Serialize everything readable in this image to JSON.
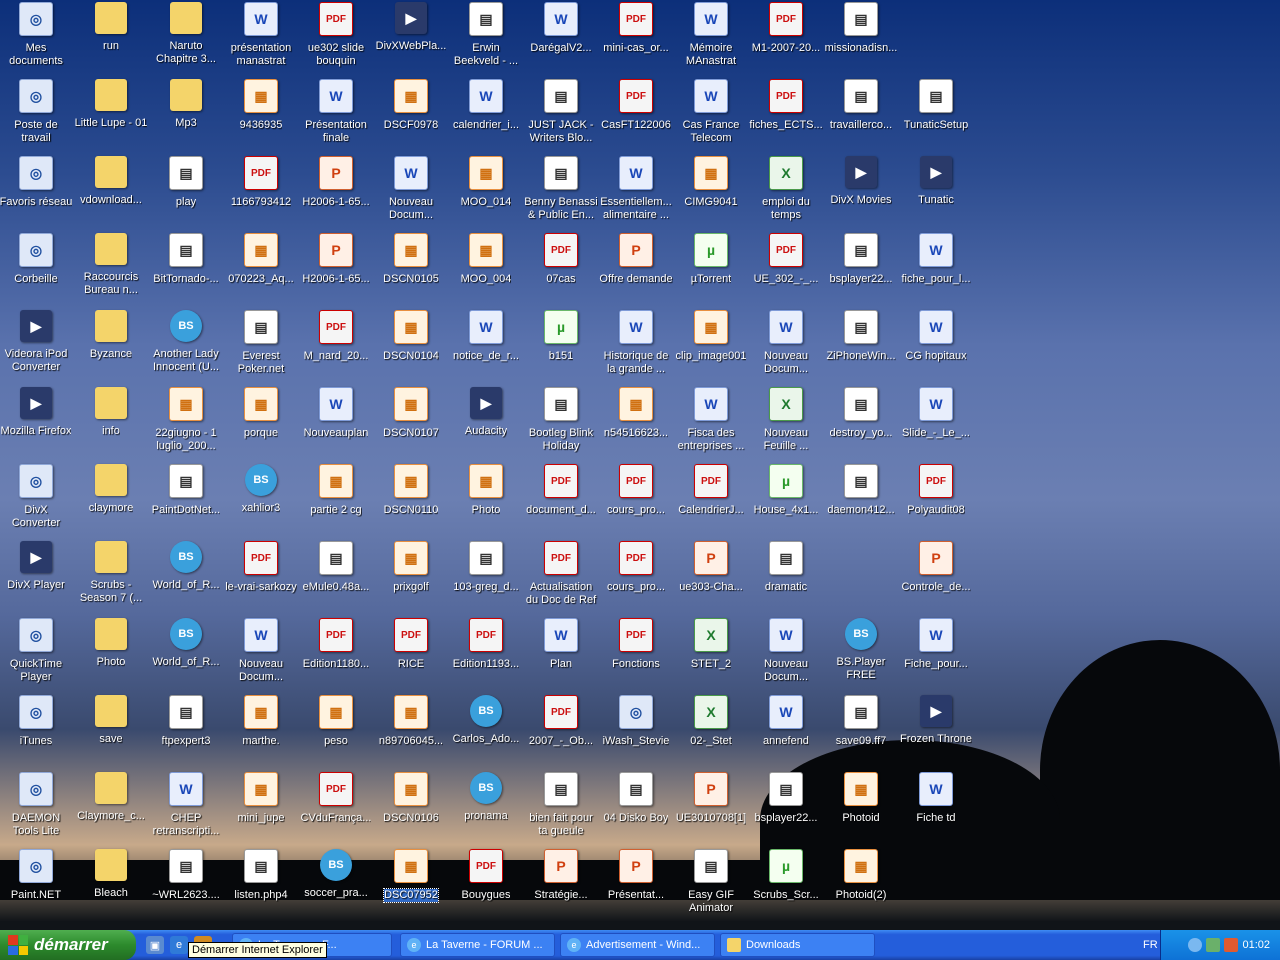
{
  "desktop": {
    "columns": [
      [
        {
          "label": "Mes documents",
          "icon": "my-documents-icon",
          "type": "sys"
        },
        {
          "label": "Poste de travail",
          "icon": "my-computer-icon",
          "type": "sys"
        },
        {
          "label": "Favoris réseau",
          "icon": "network-icon",
          "type": "sys"
        },
        {
          "label": "Corbeille",
          "icon": "recycle-bin-icon",
          "type": "sys"
        },
        {
          "label": "Videora iPod Converter",
          "icon": "videora-icon",
          "type": "app"
        },
        {
          "label": "Mozilla Firefox",
          "icon": "firefox-icon",
          "type": "app"
        },
        {
          "label": "DivX Converter",
          "icon": "divx-converter-icon",
          "type": "sys"
        },
        {
          "label": "DivX Player",
          "icon": "divx-player-icon",
          "type": "app"
        },
        {
          "label": "QuickTime Player",
          "icon": "quicktime-icon",
          "type": "sys"
        },
        {
          "label": "iTunes",
          "icon": "itunes-icon",
          "type": "sys"
        },
        {
          "label": "DAEMON Tools Lite",
          "icon": "daemon-tools-icon",
          "type": "sys"
        },
        {
          "label": "Paint.NET",
          "icon": "paint-net-icon",
          "type": "sys"
        }
      ],
      [
        {
          "label": "run",
          "icon": "folder-icon",
          "type": "folder"
        },
        {
          "label": "Little Lupe - 01",
          "icon": "folder-icon",
          "type": "folder"
        },
        {
          "label": "vdownload...",
          "icon": "folder-icon",
          "type": "folder"
        },
        {
          "label": "Raccourcis Bureau n...",
          "icon": "folder-icon",
          "type": "folder"
        },
        {
          "label": "Byzance",
          "icon": "folder-icon",
          "type": "folder"
        },
        {
          "label": "info",
          "icon": "folder-icon",
          "type": "folder"
        },
        {
          "label": "claymore",
          "icon": "folder-icon",
          "type": "folder"
        },
        {
          "label": "Scrubs - Season 7 (...",
          "icon": "folder-icon",
          "type": "folder"
        },
        {
          "label": "Photo",
          "icon": "folder-icon",
          "type": "folder"
        },
        {
          "label": "save",
          "icon": "folder-icon",
          "type": "folder"
        },
        {
          "label": "Claymore_c...",
          "icon": "folder-icon",
          "type": "folder"
        },
        {
          "label": "Bleach",
          "icon": "folder-icon",
          "type": "folder"
        }
      ],
      [
        {
          "label": "Naruto Chapitre 3...",
          "icon": "folder-icon",
          "type": "folder"
        },
        {
          "label": "Mp3",
          "icon": "folder-icon",
          "type": "folder"
        },
        {
          "label": "play",
          "icon": "movie-icon",
          "type": "misc"
        },
        {
          "label": "BitTornado-...",
          "icon": "bittornado-icon",
          "type": "misc"
        },
        {
          "label": "Another Lady Innocent (U...",
          "icon": "bsplayer-icon",
          "type": "bs"
        },
        {
          "label": "22giugno - 1 luglio_200...",
          "icon": "image-icon",
          "type": "img"
        },
        {
          "label": "PaintDotNet...",
          "icon": "paintdotnet-icon",
          "type": "misc"
        },
        {
          "label": "World_of_R...",
          "icon": "bsplayer-icon",
          "type": "bs"
        },
        {
          "label": "World_of_R...",
          "icon": "bsplayer-icon",
          "type": "bs"
        },
        {
          "label": "ftpexpert3",
          "icon": "installer-icon",
          "type": "misc"
        },
        {
          "label": "CHEP retranscripti...",
          "icon": "word-doc-icon",
          "type": "word"
        },
        {
          "label": "~WRL2623....",
          "icon": "archive-icon",
          "type": "misc"
        }
      ],
      [
        {
          "label": "présentation manastrat",
          "icon": "word-doc-icon",
          "type": "word"
        },
        {
          "label": "9436935",
          "icon": "image-icon",
          "type": "img"
        },
        {
          "label": "1166793412",
          "icon": "pdf-icon",
          "type": "pdf"
        },
        {
          "label": "070223_Aq...",
          "icon": "image-icon",
          "type": "img"
        },
        {
          "label": "Everest Poker.net",
          "icon": "everest-poker-icon",
          "type": "misc"
        },
        {
          "label": "porque",
          "icon": "image-icon",
          "type": "img"
        },
        {
          "label": "xahlior3",
          "icon": "bsplayer-icon",
          "type": "bs"
        },
        {
          "label": "le-vrai-sarkozy",
          "icon": "pdf-icon",
          "type": "pdf"
        },
        {
          "label": "Nouveau Docum...",
          "icon": "word-doc-icon",
          "type": "word"
        },
        {
          "label": "marthe.",
          "icon": "image-icon",
          "type": "img"
        },
        {
          "label": "mini_jupe",
          "icon": "image-icon",
          "type": "img"
        },
        {
          "label": "listen.php4",
          "icon": "file-icon",
          "type": "misc"
        }
      ],
      [
        {
          "label": "ue302 slide bouquin",
          "icon": "pdf-icon",
          "type": "pdf"
        },
        {
          "label": "Présentation finale",
          "icon": "word-doc-icon",
          "type": "word"
        },
        {
          "label": "H2006-1-65...",
          "icon": "powerpoint-icon",
          "type": "ppt"
        },
        {
          "label": "H2006-1-65...",
          "icon": "powerpoint-icon",
          "type": "ppt"
        },
        {
          "label": "M_nard_20...",
          "icon": "pdf-icon",
          "type": "pdf"
        },
        {
          "label": "Nouveauplan",
          "icon": "word-doc-icon",
          "type": "word"
        },
        {
          "label": "partie 2 cg",
          "icon": "image-icon",
          "type": "img"
        },
        {
          "label": "eMule0.48a...",
          "icon": "installer-icon",
          "type": "misc"
        },
        {
          "label": "Edition1180...",
          "icon": "pdf-icon",
          "type": "pdf"
        },
        {
          "label": "peso",
          "icon": "image-icon",
          "type": "img"
        },
        {
          "label": "CVduFrança...",
          "icon": "pdf-icon",
          "type": "pdf"
        },
        {
          "label": "soccer_pra...",
          "icon": "bsplayer-icon",
          "type": "bs"
        }
      ],
      [
        {
          "label": "DivXWebPla...",
          "icon": "divx-web-player-icon",
          "type": "app"
        },
        {
          "label": "DSCF0978",
          "icon": "image-icon",
          "type": "img"
        },
        {
          "label": "Nouveau Docum...",
          "icon": "word-doc-icon",
          "type": "word"
        },
        {
          "label": "DSCN0105",
          "icon": "image-icon",
          "type": "img"
        },
        {
          "label": "DSCN0104",
          "icon": "image-icon",
          "type": "img"
        },
        {
          "label": "DSCN0107",
          "icon": "image-icon",
          "type": "img"
        },
        {
          "label": "DSCN0110",
          "icon": "image-icon",
          "type": "img"
        },
        {
          "label": "prixgolf",
          "icon": "image-icon",
          "type": "img"
        },
        {
          "label": "RICE",
          "icon": "pdf-icon",
          "type": "pdf"
        },
        {
          "label": "n89706045...",
          "icon": "image-icon",
          "type": "img"
        },
        {
          "label": "DSCN0106",
          "icon": "image-icon",
          "type": "img"
        },
        {
          "label": "DSC07952",
          "icon": "image-icon",
          "type": "img",
          "selected": true
        }
      ],
      [
        {
          "label": "Erwin Beekveld - ...",
          "icon": "media-file-icon",
          "type": "misc"
        },
        {
          "label": "calendrier_i...",
          "icon": "word-doc-icon",
          "type": "word"
        },
        {
          "label": "MOO_014",
          "icon": "image-icon",
          "type": "img"
        },
        {
          "label": "MOO_004",
          "icon": "image-icon",
          "type": "img"
        },
        {
          "label": "notice_de_r...",
          "icon": "word-doc-icon",
          "type": "word"
        },
        {
          "label": "Audacity",
          "icon": "audacity-icon",
          "type": "app"
        },
        {
          "label": "Photo",
          "icon": "image-icon",
          "type": "img"
        },
        {
          "label": "103-greg_d...",
          "icon": "media-file-icon",
          "type": "misc"
        },
        {
          "label": "Edition1193...",
          "icon": "pdf-icon",
          "type": "pdf"
        },
        {
          "label": "Carlos_Ado...",
          "icon": "bsplayer-icon",
          "type": "bs"
        },
        {
          "label": "pronama",
          "icon": "bsplayer-icon",
          "type": "bs"
        },
        {
          "label": "Bouygues",
          "icon": "pdf-icon",
          "type": "pdf"
        }
      ],
      [
        {
          "label": "DarégalV2...",
          "icon": "word-doc-icon",
          "type": "word"
        },
        {
          "label": "JUST JACK - Writers Blo...",
          "icon": "media-file-icon",
          "type": "misc"
        },
        {
          "label": "Benny Benassi & Public En...",
          "icon": "media-file-icon",
          "type": "misc"
        },
        {
          "label": "07cas",
          "icon": "pdf-icon",
          "type": "pdf"
        },
        {
          "label": "b151",
          "icon": "torrent-file-icon",
          "type": "torrent"
        },
        {
          "label": "Bootleg Blink Holiday",
          "icon": "media-file-icon",
          "type": "misc"
        },
        {
          "label": "document_d...",
          "icon": "pdf-icon",
          "type": "pdf"
        },
        {
          "label": "Actualisation du Doc de Ref",
          "icon": "pdf-icon",
          "type": "pdf"
        },
        {
          "label": "Plan",
          "icon": "word-doc-icon",
          "type": "word"
        },
        {
          "label": "2007_-_Ob...",
          "icon": "pdf-icon",
          "type": "pdf"
        },
        {
          "label": "bien fait pour ta gueule",
          "icon": "media-file-icon",
          "type": "misc"
        },
        {
          "label": "Stratégie...",
          "icon": "powerpoint-icon",
          "type": "ppt"
        }
      ],
      [
        {
          "label": "mini-cas_or...",
          "icon": "pdf-icon",
          "type": "pdf"
        },
        {
          "label": "CasFT122006",
          "icon": "pdf-icon",
          "type": "pdf"
        },
        {
          "label": "Essentiellem... alimentaire ...",
          "icon": "word-doc-icon",
          "type": "word"
        },
        {
          "label": "Offre demande",
          "icon": "powerpoint-icon",
          "type": "ppt"
        },
        {
          "label": "Historique de la grande ...",
          "icon": "word-doc-icon",
          "type": "word"
        },
        {
          "label": "n54516623...",
          "icon": "image-icon",
          "type": "img"
        },
        {
          "label": "cours_pro...",
          "icon": "pdf-icon",
          "type": "pdf"
        },
        {
          "label": "cours_pro...",
          "icon": "pdf-icon",
          "type": "pdf"
        },
        {
          "label": "Fonctions",
          "icon": "pdf-icon",
          "type": "pdf"
        },
        {
          "label": "iWash_Stevie",
          "icon": "media-player-icon",
          "type": "sys"
        },
        {
          "label": "04 Disko Boy",
          "icon": "media-file-icon",
          "type": "misc"
        },
        {
          "label": "Présentat...",
          "icon": "powerpoint-icon",
          "type": "ppt"
        }
      ],
      [
        {
          "label": "Mémoire MAnastrat",
          "icon": "word-doc-icon",
          "type": "word"
        },
        {
          "label": "Cas France Telecom",
          "icon": "word-doc-icon",
          "type": "word"
        },
        {
          "label": "CIMG9041",
          "icon": "image-icon",
          "type": "img"
        },
        {
          "label": "µTorrent",
          "icon": "utorrent-icon",
          "type": "torrent"
        },
        {
          "label": "clip_image001",
          "icon": "image-icon",
          "type": "img"
        },
        {
          "label": "Fisca des entreprises ...",
          "icon": "word-doc-icon",
          "type": "word"
        },
        {
          "label": "CalendrierJ...",
          "icon": "pdf-icon",
          "type": "pdf"
        },
        {
          "label": "ue303-Cha...",
          "icon": "powerpoint-icon",
          "type": "ppt"
        },
        {
          "label": "STET_2",
          "icon": "excel-icon",
          "type": "xls"
        },
        {
          "label": "02-_Stet",
          "icon": "excel-icon",
          "type": "xls"
        },
        {
          "label": "UE3010708[1]",
          "icon": "powerpoint-icon",
          "type": "ppt"
        },
        {
          "label": "Easy GIF Animator",
          "icon": "gif-animator-icon",
          "type": "misc"
        }
      ],
      [
        {
          "label": "M1-2007-20...",
          "icon": "pdf-icon",
          "type": "pdf"
        },
        {
          "label": "fiches_ECTS...",
          "icon": "pdf-icon",
          "type": "pdf"
        },
        {
          "label": "emploi du temps",
          "icon": "excel-icon",
          "type": "xls"
        },
        {
          "label": "UE_302_-_...",
          "icon": "pdf-icon",
          "type": "pdf"
        },
        {
          "label": "Nouveau Docum...",
          "icon": "word-doc-icon",
          "type": "word"
        },
        {
          "label": "Nouveau Feuille ...",
          "icon": "excel-icon",
          "type": "xls"
        },
        {
          "label": "House_4x1...",
          "icon": "torrent-file-icon",
          "type": "torrent"
        },
        {
          "label": "dramatic",
          "icon": "media-file-icon",
          "type": "misc"
        },
        {
          "label": "Nouveau Docum...",
          "icon": "word-doc-icon",
          "type": "word"
        },
        {
          "label": "annefend",
          "icon": "text-doc-icon",
          "type": "word"
        },
        {
          "label": "bsplayer22...",
          "icon": "installer-icon",
          "type": "misc"
        },
        {
          "label": "Scrubs_Scr...",
          "icon": "torrent-file-icon",
          "type": "torrent"
        }
      ],
      [
        {
          "label": "missionadisn...",
          "icon": "media-file-icon",
          "type": "misc"
        },
        {
          "label": "travaillerco...",
          "icon": "media-file-icon",
          "type": "misc"
        },
        {
          "label": "DivX Movies",
          "icon": "divx-movies-icon",
          "type": "app"
        },
        {
          "label": "bsplayer22...",
          "icon": "installer-icon",
          "type": "misc"
        },
        {
          "label": "ZiPhoneWin...",
          "icon": "sfx-archive-icon",
          "type": "misc"
        },
        {
          "label": "destroy_yo...",
          "icon": "media-file-icon",
          "type": "misc"
        },
        {
          "label": "daemon412...",
          "icon": "daemon-setup-icon",
          "type": "misc"
        },
        null,
        {
          "label": "BS.Player FREE",
          "icon": "bsplayer-icon",
          "type": "bs"
        },
        {
          "label": "save09.ff7",
          "icon": "file-icon",
          "type": "misc"
        },
        {
          "label": "Photoid",
          "icon": "image-icon",
          "type": "img"
        },
        {
          "label": "Photoid(2)",
          "icon": "image-icon",
          "type": "img"
        }
      ],
      [
        null,
        {
          "label": "TunaticSetup",
          "icon": "setup-icon",
          "type": "misc"
        },
        {
          "label": "Tunatic",
          "icon": "tunatic-icon",
          "type": "app"
        },
        {
          "label": "fiche_pour_l...",
          "icon": "word-doc-icon",
          "type": "word"
        },
        {
          "label": "CG hopitaux",
          "icon": "word-doc-icon",
          "type": "word"
        },
        {
          "label": "Slide_-_Le_...",
          "icon": "word-doc-icon",
          "type": "word"
        },
        {
          "label": "Polyaudit08",
          "icon": "pdf-icon",
          "type": "pdf"
        },
        {
          "label": "Controle_de...",
          "icon": "powerpoint-icon",
          "type": "ppt"
        },
        {
          "label": "Fiche_pour...",
          "icon": "word-doc-icon",
          "type": "word"
        },
        {
          "label": "Frozen Throne",
          "icon": "warcraft-icon",
          "type": "app"
        },
        {
          "label": "Fiche td",
          "icon": "word-doc-icon",
          "type": "word"
        },
        null
      ]
    ]
  },
  "tooltip": "Démarrer Internet Explorer",
  "taskbar": {
    "start_label": "démarrer",
    "tasks": [
      {
        "label": "La Taverna - F...",
        "icon": "ie-icon"
      },
      {
        "label": "La Taverne - FORUM ...",
        "icon": "ie-icon"
      },
      {
        "label": "Advertisement - Wind...",
        "icon": "ie-icon"
      },
      {
        "label": "Downloads",
        "icon": "folder-icon"
      }
    ],
    "language": "FR",
    "clock": "01:02"
  }
}
